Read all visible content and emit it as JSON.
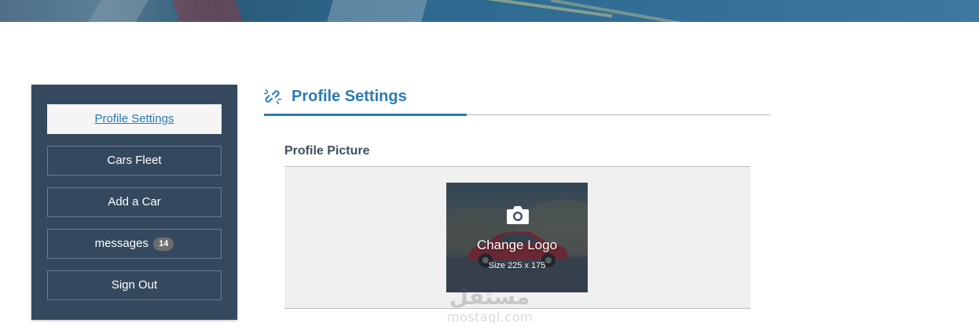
{
  "sidebar": {
    "items": [
      {
        "label": "Profile Settings"
      },
      {
        "label": "Cars Fleet"
      },
      {
        "label": "Add a Car"
      },
      {
        "label": "messages",
        "badge": "14"
      },
      {
        "label": "Sign Out"
      }
    ],
    "active_index": 0
  },
  "main": {
    "title": "Profile Settings",
    "title_icon": "unlink-icon",
    "section_title": "Profile Picture",
    "logo_upload": {
      "label": "Change Logo",
      "size_hint": "Size 225 x 175",
      "icon": "camera-icon"
    }
  },
  "watermark": {
    "brand": "مستقل",
    "domain": "mostaql.com"
  },
  "colors": {
    "accent": "#2a7ab8",
    "sidebar_bg": "#34495e",
    "badge_bg": "#6d6d6d"
  }
}
